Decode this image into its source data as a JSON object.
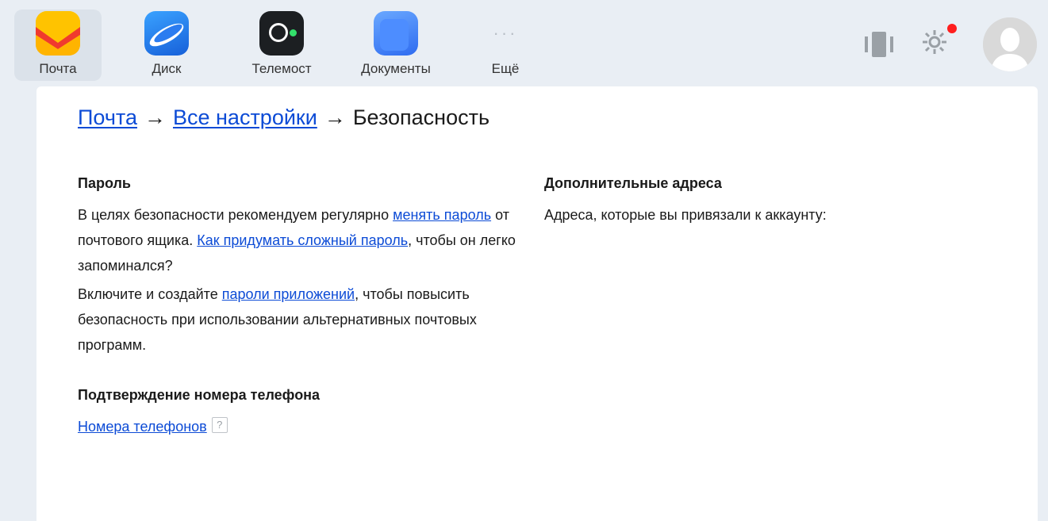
{
  "apps": [
    {
      "label": "Почта",
      "icon": "mail-icon",
      "active": true
    },
    {
      "label": "Диск",
      "icon": "disk-icon",
      "active": false
    },
    {
      "label": "Телемост",
      "icon": "telemost-icon",
      "active": false
    },
    {
      "label": "Документы",
      "icon": "documents-icon",
      "active": false
    },
    {
      "label": "Ещё",
      "icon": "more-icon",
      "active": false
    }
  ],
  "colors": {
    "accent_link": "#0c4bd6",
    "notification": "#ff1e1e",
    "background": "#e9eef4",
    "mail_yellow": "#ffc300",
    "mail_red": "#f03a2e"
  },
  "breadcrumb": {
    "item1": "Почта",
    "item2": "Все настройки",
    "current": "Безопасность",
    "separator": "→"
  },
  "password": {
    "title": "Пароль",
    "p1_text1": "В целях безопасности рекомендуем регулярно ",
    "p1_link1": "менять пароль",
    "p1_text2": " от почтового ящика. ",
    "p1_link2": "Как придумать сложный пароль",
    "p1_text3": ", чтобы он легко запоминался?",
    "p2_text1": "Включите и создайте ",
    "p2_link": "пароли приложений",
    "p2_text2": ", чтобы повысить безопасность при использовании альтернативных почтовых программ."
  },
  "phone": {
    "title": "Подтверждение номера телефона",
    "link": "Номера телефонов",
    "help": "?"
  },
  "extra_addresses": {
    "title": "Дополнительные адреса",
    "text": "Адреса, которые вы привязали к аккаунту:"
  }
}
